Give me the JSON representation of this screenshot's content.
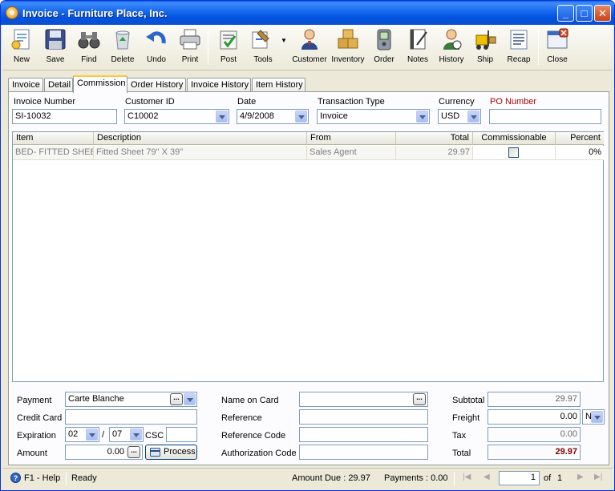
{
  "window": {
    "title": "Invoice - Furniture Place, Inc.",
    "min": "_",
    "max": "□",
    "close": "✕"
  },
  "toolbar": [
    {
      "label": "New",
      "icon": "new-document-icon"
    },
    {
      "label": "Save",
      "icon": "floppy-disk-icon"
    },
    {
      "label": "Find",
      "icon": "binoculars-icon"
    },
    {
      "label": "Delete",
      "icon": "recycle-bin-icon"
    },
    {
      "label": "Undo",
      "icon": "undo-arrow-icon"
    },
    {
      "label": "Print",
      "icon": "printer-icon"
    },
    {
      "label": "Post",
      "icon": "post-checkmark-icon"
    },
    {
      "label": "Tools",
      "icon": "tools-icon"
    },
    {
      "label": "Customer",
      "icon": "customer-person-icon"
    },
    {
      "label": "Inventory",
      "icon": "inventory-boxes-icon"
    },
    {
      "label": "Order",
      "icon": "order-device-icon"
    },
    {
      "label": "Notes",
      "icon": "notes-notebook-icon"
    },
    {
      "label": "History",
      "icon": "history-person-icon"
    },
    {
      "label": "Ship",
      "icon": "ship-forklift-icon"
    },
    {
      "label": "Recap",
      "icon": "recap-list-icon"
    },
    {
      "label": "Close",
      "icon": "close-window-icon"
    }
  ],
  "tabs": [
    "Invoice",
    "Detail",
    "Commission",
    "Order History",
    "Invoice History",
    "Item History"
  ],
  "header_fields": {
    "invoice_number_label": "Invoice Number",
    "invoice_number": "SI-10032",
    "customer_id_label": "Customer ID",
    "customer_id": "C10002",
    "date_label": "Date",
    "date": "4/9/2008",
    "transaction_type_label": "Transaction Type",
    "transaction_type": "Invoice",
    "currency_label": "Currency",
    "currency": "USD",
    "po_number_label": "PO Number",
    "po_number": ""
  },
  "grid": {
    "columns": [
      "Item",
      "Description",
      "From",
      "Total",
      "Commissionable",
      "Percent"
    ],
    "rows": [
      {
        "item": "BED- FITTED SHEET",
        "description": "Fitted Sheet 79\" X 39\"",
        "from": "Sales Agent",
        "total": "29.97",
        "commissionable": false,
        "percent": "0%"
      }
    ]
  },
  "payment": {
    "payment_label": "Payment",
    "payment": "Carte Blanche",
    "credit_card_label": "Credit Card",
    "credit_card": "",
    "expiration_label": "Expiration",
    "exp_month": "02",
    "exp_sep": "/",
    "exp_year": "07",
    "csc_label": "CSC",
    "csc": "",
    "amount_label": "Amount",
    "amount": "0.00",
    "process_label": "Process",
    "name_on_card_label": "Name on Card",
    "name_on_card": "",
    "reference_label": "Reference",
    "reference": "",
    "reference_code_label": "Reference Code",
    "reference_code": "",
    "auth_code_label": "Authorization Code",
    "auth_code": ""
  },
  "totals": {
    "subtotal_label": "Subtotal",
    "subtotal": "29.97",
    "freight_label": "Freight",
    "freight": "0.00",
    "freight_code": "N",
    "tax_label": "Tax",
    "tax": "0.00",
    "total_label": "Total",
    "total": "29.97"
  },
  "status": {
    "help": "F1 - Help",
    "state": "Ready",
    "amount_due": "Amount Due : 29.97",
    "payments": "Payments : 0.00",
    "page": "1",
    "of_label": "of",
    "total_pages": "1"
  },
  "colors": {
    "title_bar": "#0053e0",
    "active_tab_highlight": "#ffc83c",
    "total_value": "#800000",
    "po_label": "#b00000"
  }
}
